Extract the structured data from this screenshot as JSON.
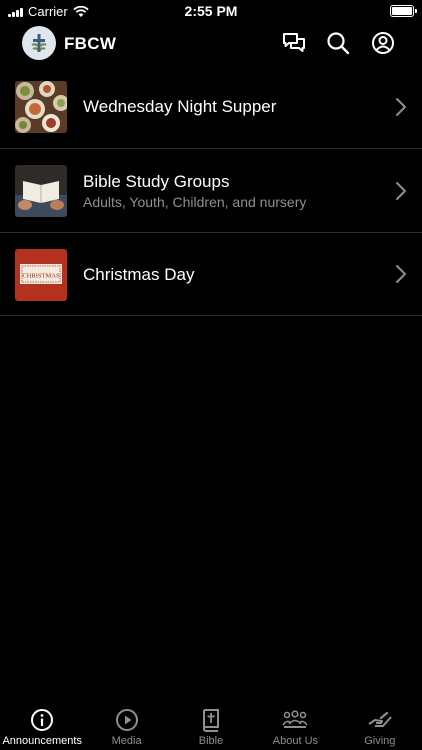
{
  "status_bar": {
    "carrier": "Carrier",
    "time": "2:55 PM"
  },
  "header": {
    "app_title": "FBCW",
    "icons": [
      "chat-bubbles-icon",
      "search-icon",
      "profile-icon"
    ]
  },
  "announcements": [
    {
      "title": "Wednesday Night Supper",
      "subtitle": "",
      "thumb": "supper-photo"
    },
    {
      "title": "Bible Study Groups",
      "subtitle": "Adults, Youth, Children, and nursery",
      "thumb": "bible-study-photo"
    },
    {
      "title": "Christmas Day",
      "subtitle": "",
      "thumb": "christmas-card",
      "thumb_text": "CHRISTMAS"
    }
  ],
  "tabs": [
    {
      "label": "Announcements",
      "icon": "info-icon",
      "active": true
    },
    {
      "label": "Media",
      "icon": "play-icon",
      "active": false
    },
    {
      "label": "Bible",
      "icon": "bible-icon",
      "active": false
    },
    {
      "label": "About Us",
      "icon": "people-icon",
      "active": false
    },
    {
      "label": "Giving",
      "icon": "giving-hand-icon",
      "active": false
    }
  ],
  "colors": {
    "background": "#000000",
    "text": "#ffffff",
    "secondary_text": "#8e8e93",
    "separator": "#2c2c2e",
    "christmas_red": "#b3321f"
  }
}
